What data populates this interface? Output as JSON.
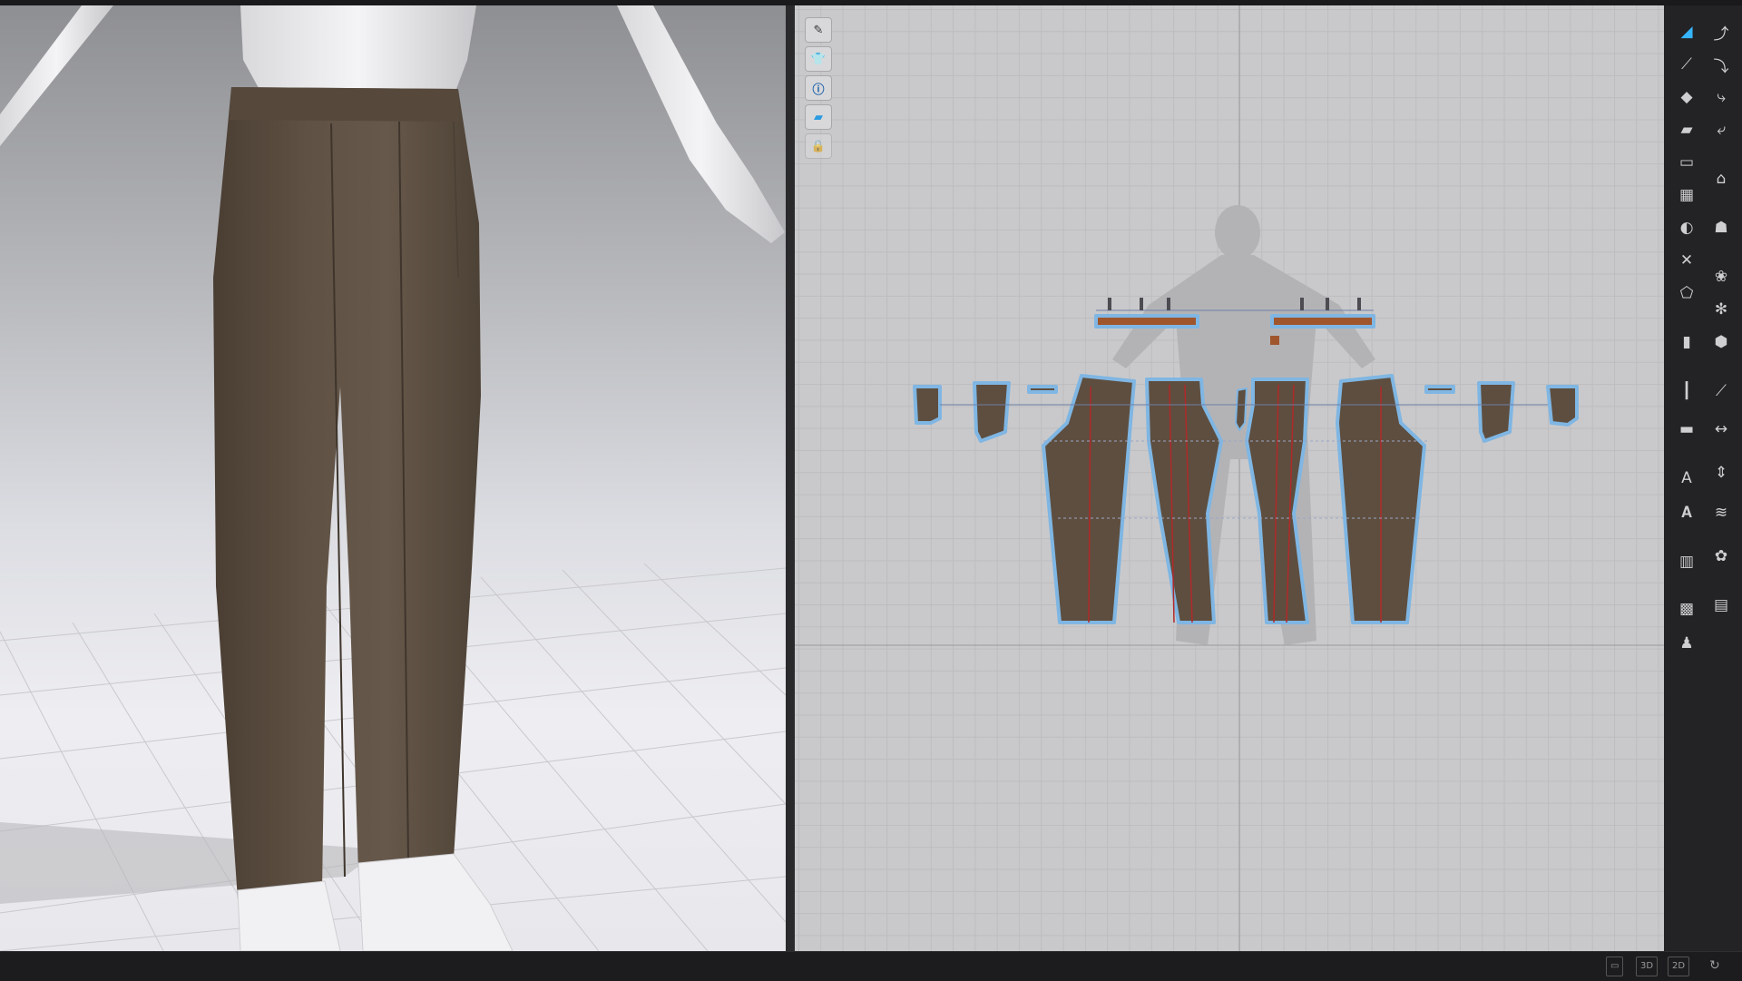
{
  "icons": {
    "view3d_tools": [
      "brush-visibility-icon",
      "garment-visibility-icon",
      "info-icon",
      "texture-icon",
      "avatar-lock-icon"
    ],
    "toolbar_left_col": [
      "select-move-icon",
      "edit-pattern-icon",
      "transform-pattern-icon",
      "polygon-icon",
      "rectangle-icon",
      "internal-polygon-icon",
      "dart-icon",
      "cut-icon",
      "fold-icon",
      "segment-sewing-icon",
      "free-sewing-icon",
      "tack-icon",
      "text-icon",
      "text-edit-icon",
      "measure-icon",
      "fabric-icon",
      "avatar-icon"
    ],
    "toolbar_right_col": [
      "edit-curvature-icon",
      "curve-point-icon",
      "add-point-icon",
      "set-seam-allowance-icon",
      "iron-icon",
      "fold-arrangement-icon",
      "button-icon",
      "buttonhole-icon",
      "topstitch-icon",
      "edit-topstitch-icon",
      "measure-length-icon",
      "zipper-icon",
      "elastic-icon",
      "zigzag-icon",
      "graphic-icon",
      "tape-icon"
    ],
    "status": [
      "single-view-icon",
      "refresh-icon"
    ]
  },
  "status_bar": {
    "view_3d": "3D",
    "view_2d": "2D"
  },
  "colors": {
    "fabric": "#5e4e3f",
    "outline": "#7fb6e3",
    "waistband": "#a0562d",
    "grain_line": "#b02a2a",
    "active_tool": "#35b5ff"
  }
}
